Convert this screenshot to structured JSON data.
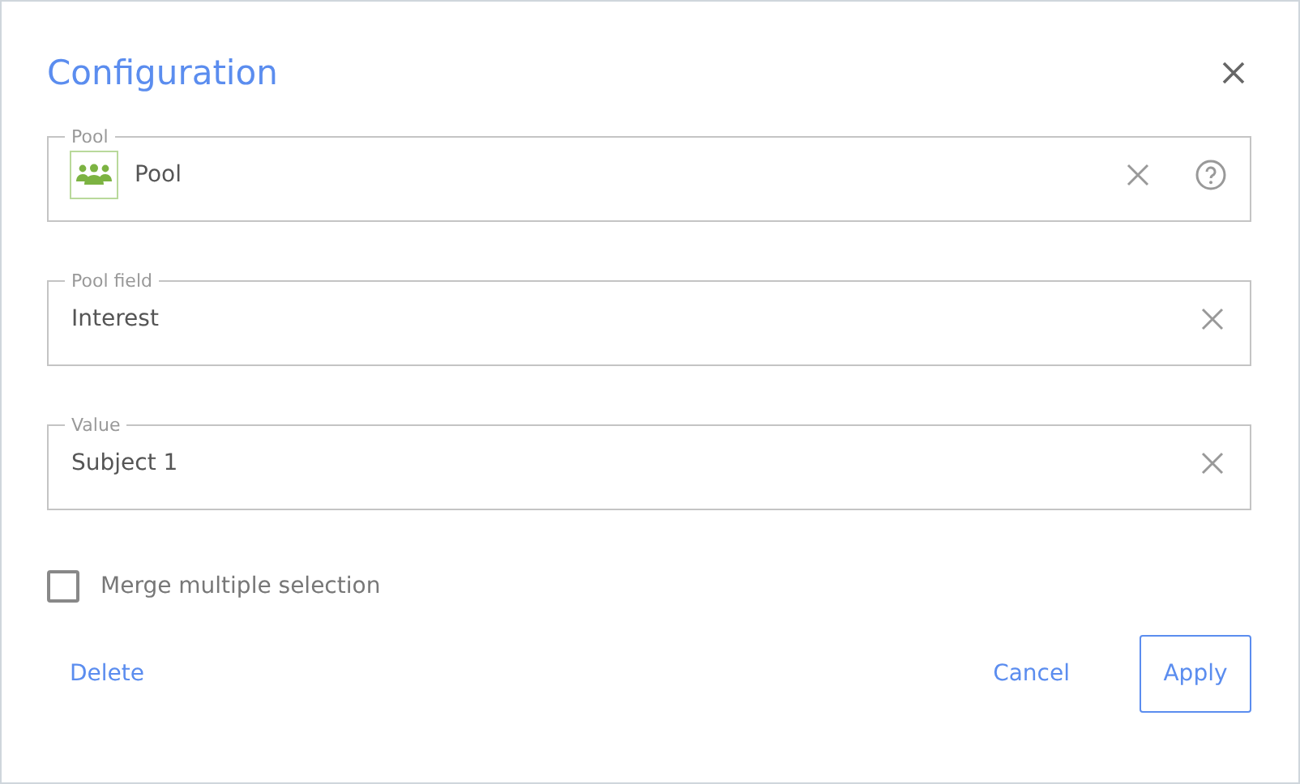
{
  "dialog": {
    "title": "Configuration"
  },
  "fields": [
    {
      "kind": "entity",
      "label": "Pool",
      "value": "Pool"
    },
    {
      "kind": "text",
      "label": "Pool field",
      "value": "Interest"
    },
    {
      "kind": "text",
      "label": "Value",
      "value": "Subject 1"
    }
  ],
  "merge_option": {
    "label": "Merge multiple selection",
    "checked": false
  },
  "buttons": {
    "delete": "Delete",
    "cancel": "Cancel",
    "apply": "Apply"
  }
}
